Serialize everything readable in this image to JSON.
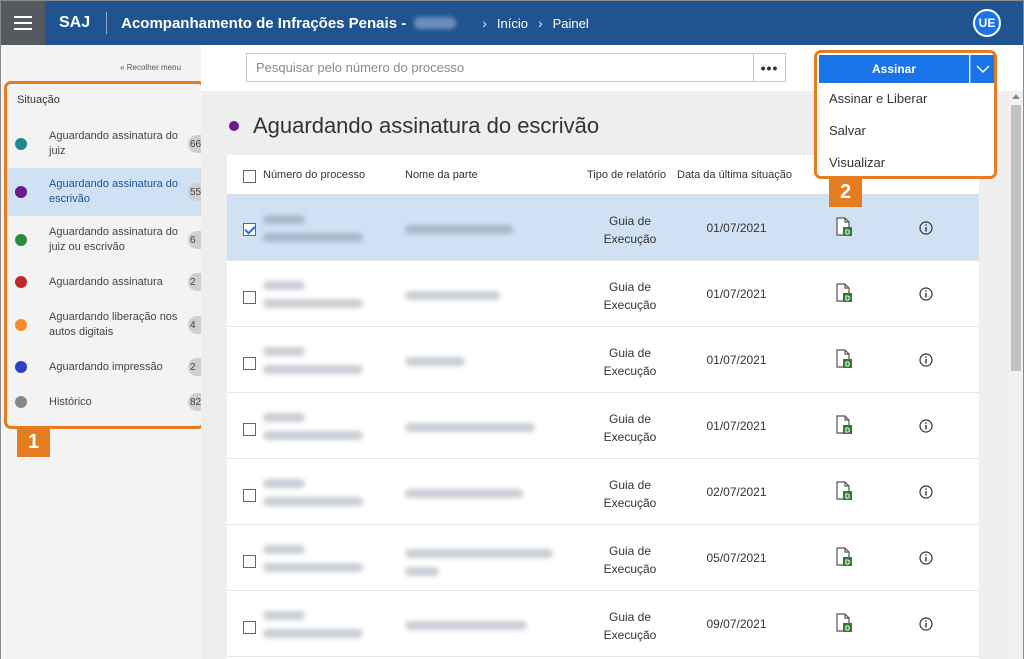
{
  "header": {
    "brand": "SAJ",
    "title": "Acompanhamento de Infrações Penais -",
    "breadcrumbs": [
      "Início",
      "Painel"
    ],
    "user_initials": "UE"
  },
  "sidebar": {
    "collapse_label": "« Recolher menu",
    "heading": "Situação",
    "items": [
      {
        "label": "Aguardando assinatura do juiz",
        "count": "66",
        "color": "#1a8a8a"
      },
      {
        "label": "Aguardando assinatura do escrivão",
        "count": "55",
        "color": "#6a1a8c"
      },
      {
        "label": "Aguardando assinatura do juiz ou escrivão",
        "count": "6",
        "color": "#2e8b3a"
      },
      {
        "label": "Aguardando assinatura",
        "count": "2",
        "color": "#c0282d"
      },
      {
        "label": "Aguardando liberação nos autos digitais",
        "count": "4",
        "color": "#f28c28"
      },
      {
        "label": "Aguardando impressão",
        "count": "2",
        "color": "#2f3fc4"
      },
      {
        "label": "Histórico",
        "count": "82",
        "color": "#888888"
      }
    ]
  },
  "callouts": {
    "one": "1",
    "two": "2"
  },
  "search": {
    "placeholder": "Pesquisar pelo número do processo",
    "more": "•••"
  },
  "actions": {
    "primary": "Assinar",
    "menu": [
      "Assinar e Liberar",
      "Salvar",
      "Visualizar"
    ]
  },
  "main": {
    "heading": "Aguardando assinatura do escrivão",
    "columns": [
      "Número do processo",
      "Nome da parte",
      "Tipo de relatório",
      "Data da última situação"
    ],
    "rows": [
      {
        "tipo_line1": "Guia de",
        "tipo_line2": "Execução",
        "date": "01/07/2021",
        "selected": true
      },
      {
        "tipo_line1": "Guia de",
        "tipo_line2": "Execução",
        "date": "01/07/2021",
        "selected": false
      },
      {
        "tipo_line1": "Guia de",
        "tipo_line2": "Execução",
        "date": "01/07/2021",
        "selected": false
      },
      {
        "tipo_line1": "Guia de",
        "tipo_line2": "Execução",
        "date": "01/07/2021",
        "selected": false
      },
      {
        "tipo_line1": "Guia de",
        "tipo_line2": "Execução",
        "date": "02/07/2021",
        "selected": false
      },
      {
        "tipo_line1": "Guia de",
        "tipo_line2": "Execução",
        "date": "05/07/2021",
        "selected": false
      },
      {
        "tipo_line1": "Guia de",
        "tipo_line2": "Execução",
        "date": "09/07/2021",
        "selected": false
      }
    ]
  },
  "colors": {
    "header": "#1f5490",
    "accent": "#1a73e8",
    "highlight": "#e57c20",
    "selected_row": "#cfe1f3"
  }
}
